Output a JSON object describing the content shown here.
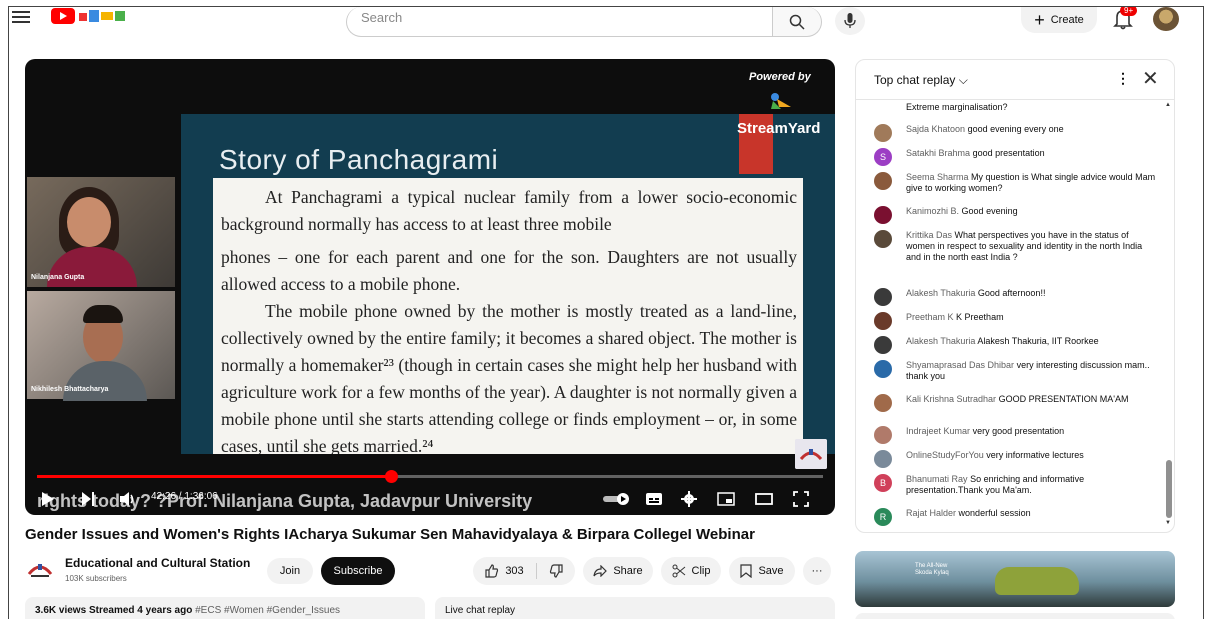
{
  "header": {
    "search_placeholder": "Search",
    "create_label": "Create",
    "notifications_badge": "9+"
  },
  "video": {
    "powered_by": "Powered by",
    "streamyard": "StreamYard",
    "slide_title": "Story of Panchagrami",
    "slide_lines": [
      "At Panchagrami a typical nuclear family from a lower socio-economic background normally has access to at least three mobile",
      "phones – one for each parent and one for the son. Daughters are not usually allowed access to a mobile phone.",
      "The mobile phone owned by the mother is mostly treated as a land-line, collectively owned by the entire family; it becomes a shared object. The mother is normally a homemaker²³ (though in certain cases she might help her husband with agriculture work for a few months of the year). A daughter is not normally given a mobile phone until she starts attending college or finds employment – or, in some cases, until she gets married.²⁴"
    ],
    "speaker1": "Nilanjana Gupta",
    "speaker2": "Nikhilesh Bhattacharya",
    "time_display": "42:26 / 1:36:06",
    "progress": 0.45,
    "overlay_title": "rights today? ?Prof. Nilanjana Gupta, Jadavpur University"
  },
  "info": {
    "title": "Gender Issues and Women's Rights  IAcharya Sukumar Sen Mahavidyalaya & Birpara CollegeI Webinar",
    "channel_name": "Educational and Cultural Station",
    "subscribers": "103K subscribers",
    "join_label": "Join",
    "subscribe_label": "Subscribe",
    "likes": "303",
    "share_label": "Share",
    "clip_label": "Clip",
    "save_label": "Save",
    "more_label": "···",
    "views": "3.6K views",
    "streamed": "Streamed 4 years ago",
    "tags": "#ECS #Women #Gender_Issues",
    "live_chat_replay": "Live chat replay"
  },
  "chat": {
    "header_title": "Top chat replay",
    "messages": [
      {
        "author": "",
        "text": "Extreme marginalisation?",
        "avatar_color": ""
      },
      {
        "author": "Sajda Khatoon",
        "text": "good evening every one",
        "avatar_color": "#a07a5a"
      },
      {
        "author": "Satakhi Brahma",
        "text": "good presentation",
        "avatar_color": "#9c3ec4",
        "initial": "S"
      },
      {
        "author": "Seema Sharma",
        "text": "My question is What single advice would Mam give to working women?",
        "avatar_color": "#8a5a3c"
      },
      {
        "author": "Kanimozhi B.",
        "text": "Good evening",
        "avatar_color": "#7a1030"
      },
      {
        "author": "Krittika Das",
        "text": "What perspectives you have in the status of women in respect to sexuality and identity in the north India and in the north east India ?",
        "avatar_color": "#5a4a3a"
      },
      {
        "author": "Alakesh Thakuria",
        "text": "Good afternoon!!",
        "avatar_color": "#3a3a3a"
      },
      {
        "author": "Preetham K",
        "text": "K Preetham",
        "avatar_color": "#6a3a2a"
      },
      {
        "author": "Alakesh Thakuria",
        "text": "Alakesh Thakuria, IIT Roorkee",
        "avatar_color": "#3a3a3a"
      },
      {
        "author": "Shyamaprasad Das Dhibar",
        "text": "very interesting discussion mam.. thank you",
        "avatar_color": "#2a6aa8"
      },
      {
        "author": "Kali Krishna Sutradhar",
        "text": "GOOD PRESENTATION MA'AM",
        "avatar_color": "#a06a4a"
      },
      {
        "author": "Indrajeet Kumar",
        "text": "very good presentation",
        "avatar_color": "#b07a6a"
      },
      {
        "author": "OnlineStudyForYou",
        "text": "very informative lectures",
        "avatar_color": "#7a8a9a"
      },
      {
        "author": "Bhanumati Ray",
        "text": "So enriching and informative presentation.Thank you Ma'am.",
        "avatar_color": "#d0405a",
        "initial": "B"
      },
      {
        "author": "Rajat Halder",
        "text": "wonderful session",
        "avatar_color": "#2a8a5a",
        "initial": "R"
      }
    ]
  },
  "ad": {
    "text_line1": "The All-New",
    "text_line2": "Skoda Kylaq"
  },
  "colors": {
    "accent_red": "#ff0000",
    "slide_bg": "#123d50",
    "streamyard_red": "#c8352a"
  }
}
